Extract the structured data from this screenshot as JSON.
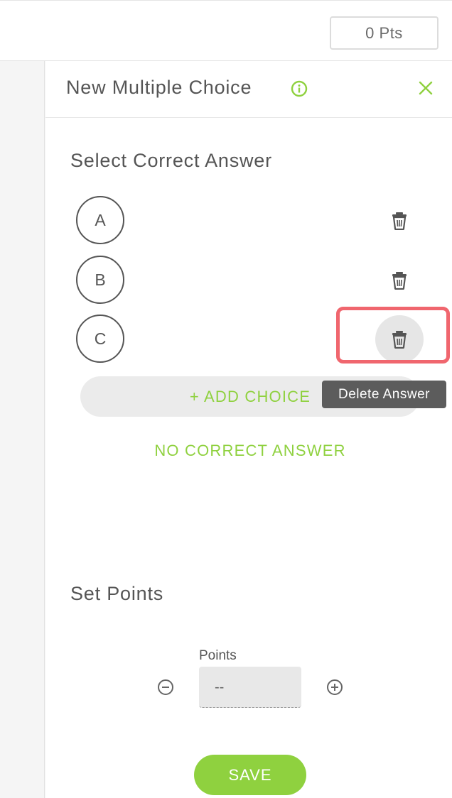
{
  "header": {
    "points_badge": "0 Pts"
  },
  "panel": {
    "title": "New Multiple Choice",
    "section_answers": "Select Correct Answer",
    "choices": [
      {
        "label": "A"
      },
      {
        "label": "B"
      },
      {
        "label": "C"
      }
    ],
    "add_choice": "+ ADD CHOICE",
    "tooltip": "Delete Answer",
    "no_correct": "NO CORRECT ANSWER",
    "section_points": "Set Points",
    "points_label": "Points",
    "points_value": "--",
    "save": "SAVE"
  },
  "icons": {
    "info": "info-icon",
    "close": "close-icon",
    "trash": "trash-icon",
    "minus": "minus-circle-icon",
    "plus": "plus-circle-icon"
  },
  "colors": {
    "accent": "#8fd13f",
    "highlight": "#f0666e",
    "tooltip_bg": "#5c5c5c"
  }
}
